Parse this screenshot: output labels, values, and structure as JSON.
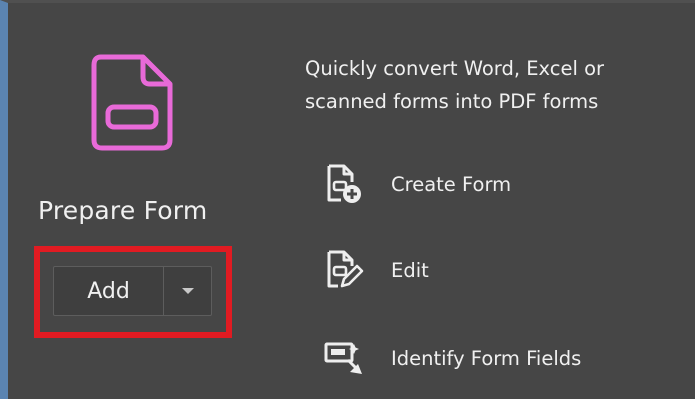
{
  "tool": {
    "title": "Prepare Form",
    "icon": "prepare-form-document-icon",
    "icon_color": "#e86ad8",
    "add_label": "Add",
    "dropdown_icon": "caret-down-icon"
  },
  "highlight_color": "#e11b22",
  "description": {
    "line1": "Quickly convert Word, Excel or",
    "line2": "scanned forms into PDF forms"
  },
  "actions": [
    {
      "label": "Create Form",
      "icon": "create-form-icon"
    },
    {
      "label": "Edit",
      "icon": "edit-form-icon"
    },
    {
      "label": "Identify Form Fields",
      "icon": "identify-form-fields-icon"
    }
  ]
}
